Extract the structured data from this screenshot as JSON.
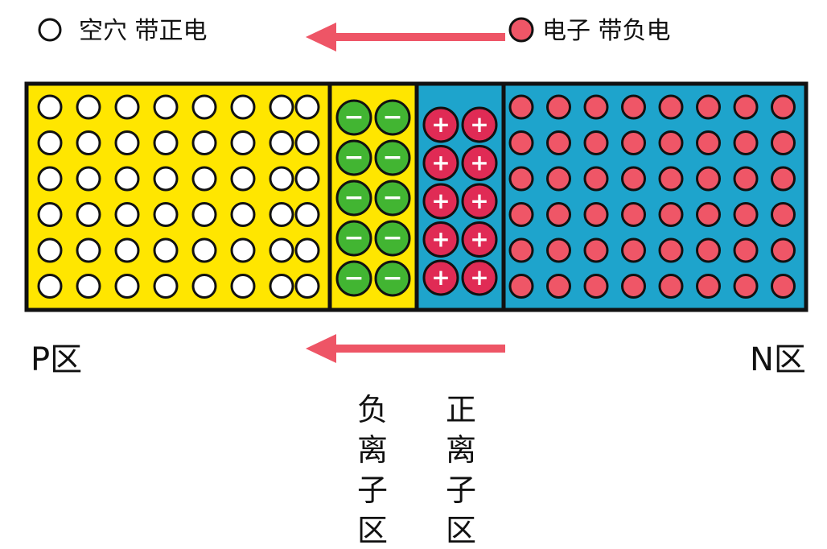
{
  "legend": {
    "hole_label": "空穴 带正电",
    "electron_label": "电子 带负电"
  },
  "regions": {
    "p_label": "P区",
    "n_label": "N区",
    "negative_ion_label": "负离子区",
    "positive_ion_label": "正离子区"
  },
  "charges": {
    "negative_sign": "−",
    "positive_sign": "+"
  },
  "counts": {
    "rows": 6,
    "p_holes_per_row": 8,
    "n_electrons_per_row": 8,
    "ion_rows": 5,
    "ion_columns": 2
  },
  "colors": {
    "p_region": "#ffe600",
    "n_region": "#1ea4cc",
    "electron": "#ef5667",
    "positive_ion": "#e02b55",
    "negative_ion": "#42b532",
    "arrow": "#ee5566",
    "outline": "#111111"
  }
}
